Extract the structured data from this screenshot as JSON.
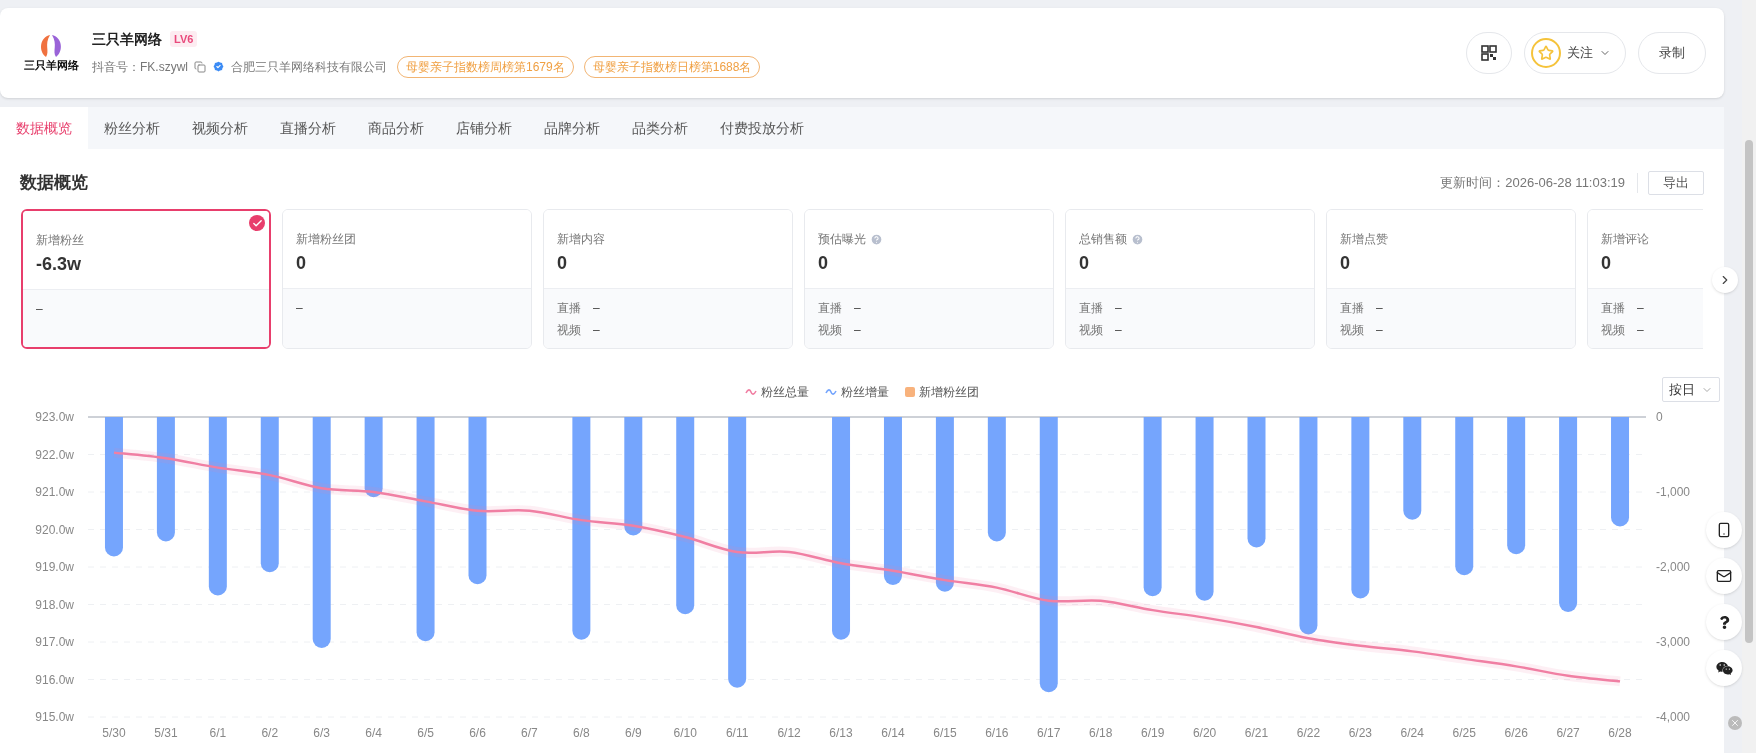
{
  "header": {
    "logo_text": "三只羊网络",
    "name": "三只羊网络",
    "level": "LV6",
    "account": "抖音号：FK.szywl",
    "company": "合肥三只羊网络科技有限公司",
    "rank_tags": [
      "母婴亲子指数榜周榜第1679名",
      "母婴亲子指数榜日榜第1688名"
    ],
    "buttons": [
      {
        "kind": "qr"
      },
      {
        "kind": "follow",
        "label": "关注"
      },
      {
        "kind": "text",
        "label": "录制"
      }
    ]
  },
  "tabs": [
    {
      "label": "数据概览",
      "selected": true
    },
    {
      "label": "粉丝分析",
      "selected": false
    },
    {
      "label": "视频分析",
      "selected": false
    },
    {
      "label": "直播分析",
      "selected": false
    },
    {
      "label": "商品分析",
      "selected": false
    },
    {
      "label": "店铺分析",
      "selected": false
    },
    {
      "label": "品牌分析",
      "selected": false
    },
    {
      "label": "品类分析",
      "selected": false
    },
    {
      "label": "付费投放分析",
      "selected": false
    }
  ],
  "overview": {
    "title": "数据概览",
    "updated": "更新时间：2026-06-28 11:03:19",
    "export_button": "导出",
    "cards": [
      {
        "label": "新增粉丝",
        "value": "-6.3w",
        "help": false,
        "selected": true,
        "footer": [
          {
            "value": "–"
          }
        ]
      },
      {
        "label": "新增粉丝团",
        "value": "0",
        "help": false,
        "selected": false,
        "footer": [
          {
            "value": "–"
          }
        ]
      },
      {
        "label": "新增内容",
        "value": "0",
        "help": false,
        "selected": false,
        "footer": [
          {
            "label": "直播",
            "value": "–"
          },
          {
            "label": "视频",
            "value": "–"
          }
        ]
      },
      {
        "label": "预估曝光",
        "value": "0",
        "help": true,
        "selected": false,
        "footer": [
          {
            "label": "直播",
            "value": "–"
          },
          {
            "label": "视频",
            "value": "–"
          }
        ]
      },
      {
        "label": "总销售额",
        "value": "0",
        "help": true,
        "selected": false,
        "footer": [
          {
            "label": "直播",
            "value": "–"
          },
          {
            "label": "视频",
            "value": "–"
          }
        ]
      },
      {
        "label": "新增点赞",
        "value": "0",
        "help": false,
        "selected": false,
        "footer": [
          {
            "label": "直播",
            "value": "–"
          },
          {
            "label": "视频",
            "value": "–"
          }
        ]
      },
      {
        "label": "新增评论",
        "value": "0",
        "help": false,
        "selected": false,
        "footer": [
          {
            "label": "直播",
            "value": "–"
          },
          {
            "label": "视频",
            "value": "–"
          }
        ]
      }
    ]
  },
  "chart": {
    "legend_markers": [
      {
        "kind": "wave"
      },
      {
        "kind": "wave"
      },
      {
        "kind": "square"
      }
    ],
    "period_select": "按日",
    "chart_data": {
      "type": "bar",
      "categories": [
        "5/30",
        "5/31",
        "6/1",
        "6/2",
        "6/3",
        "6/4",
        "6/5",
        "6/6",
        "6/7",
        "6/8",
        "6/9",
        "6/10",
        "6/11",
        "6/12",
        "6/13",
        "6/14",
        "6/15",
        "6/16",
        "6/17",
        "6/18",
        "6/19",
        "6/20",
        "6/21",
        "6/22",
        "6/23",
        "6/24",
        "6/25",
        "6/26",
        "6/27",
        "6/28"
      ],
      "series": [
        {
          "name": "粉丝总量",
          "color": "#f07fa3",
          "type": "line",
          "values": [
            922.05,
            921.9,
            921.65,
            921.45,
            921.1,
            921.0,
            920.75,
            920.5,
            920.5,
            920.25,
            920.1,
            919.8,
            919.4,
            919.4,
            919.1,
            918.9,
            918.65,
            918.45,
            918.1,
            918.1,
            917.85,
            917.65,
            917.4,
            917.1,
            916.9,
            916.75,
            916.55,
            916.35,
            916.1,
            915.95
          ]
        },
        {
          "name": "粉丝增量",
          "color": "#75a5fd",
          "type": "bar",
          "axis": "y2",
          "values": [
            -1860,
            -1660,
            -2380,
            -2070,
            -3080,
            -1070,
            -2990,
            -2230,
            null,
            -2970,
            -1580,
            -2630,
            -3610,
            null,
            -2970,
            -2240,
            -2330,
            -1660,
            -3670,
            null,
            -2390,
            -2450,
            -1740,
            -2900,
            -2420,
            -1370,
            -2110,
            -1830,
            -2600,
            -1460
          ]
        },
        {
          "name": "新增粉丝团",
          "color": "#f8b27c",
          "type": "bar",
          "values": [
            null,
            null,
            null,
            null,
            null,
            null,
            null,
            null,
            null,
            null,
            null,
            null,
            null,
            null,
            null,
            null,
            null,
            null,
            null,
            null,
            null,
            null,
            null,
            null,
            null,
            null,
            null,
            null,
            null,
            null
          ]
        }
      ],
      "grid": true,
      "ylim": [
        915,
        923
      ],
      "yticks": [
        {
          "value": 923,
          "label": "923.0w"
        },
        {
          "value": 922,
          "label": "922.0w"
        },
        {
          "value": 921,
          "label": "921.0w"
        },
        {
          "value": 920,
          "label": "920.0w"
        },
        {
          "value": 919,
          "label": "919.0w"
        },
        {
          "value": 918,
          "label": "918.0w"
        },
        {
          "value": 917,
          "label": "917.0w"
        },
        {
          "value": 916,
          "label": "916.0w"
        },
        {
          "value": 915,
          "label": "915.0w"
        }
      ],
      "y2lim": [
        -4000,
        0
      ],
      "y2ticks": [
        {
          "value": 0,
          "label": "0"
        },
        {
          "value": -1000,
          "label": "-1,000"
        },
        {
          "value": -2000,
          "label": "-2,000"
        },
        {
          "value": -3000,
          "label": "-3,000"
        },
        {
          "value": -4000,
          "label": "-4,000"
        }
      ]
    }
  }
}
